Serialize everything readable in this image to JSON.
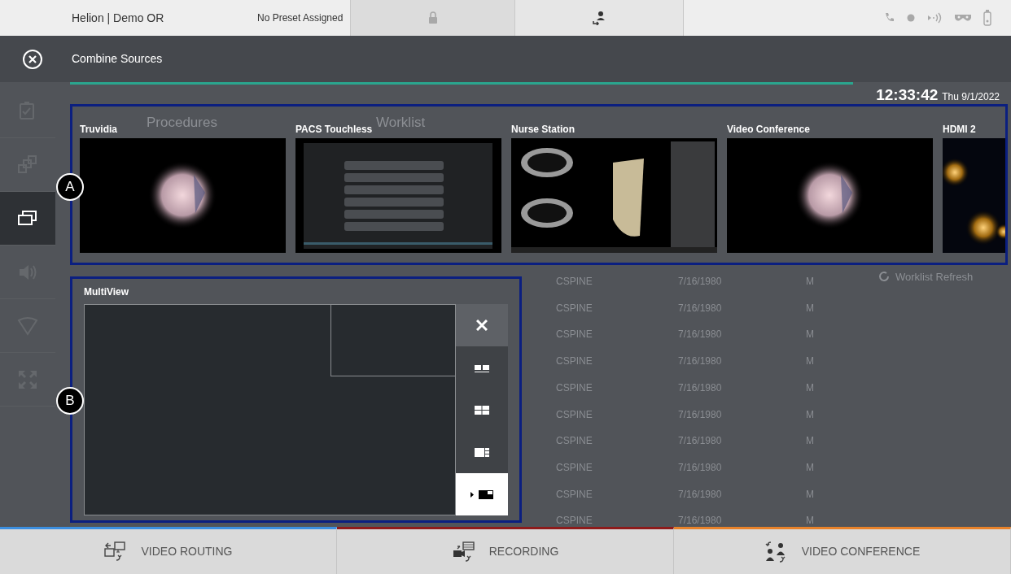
{
  "top_bar": {
    "location": "Helion | Demo OR",
    "preset": "No Preset Assigned"
  },
  "dialog": {
    "title": "Combine Sources"
  },
  "clock": {
    "time": "12:33:42",
    "date": "Thu 9/1/2022"
  },
  "sidebar": {
    "items": [
      {
        "kind": "checklist",
        "selected": false
      },
      {
        "kind": "stack",
        "selected": false
      },
      {
        "kind": "multiview",
        "selected": true
      },
      {
        "kind": "speaker",
        "selected": false
      },
      {
        "kind": "cone",
        "selected": false
      },
      {
        "kind": "expand",
        "selected": false
      }
    ]
  },
  "background": {
    "headings": [
      "Procedures",
      "Worklist"
    ],
    "refresh": "Worklist Refresh",
    "rows": [
      {
        "procedure": "CSPINE",
        "birth_date": "7/16/1980",
        "sex": "M"
      },
      {
        "procedure": "CSPINE",
        "birth_date": "7/16/1980",
        "sex": "M"
      },
      {
        "procedure": "CSPINE",
        "birth_date": "7/16/1980",
        "sex": "M"
      },
      {
        "procedure": "CSPINE",
        "birth_date": "7/16/1980",
        "sex": "M"
      },
      {
        "procedure": "CSPINE",
        "birth_date": "7/16/1980",
        "sex": "M"
      },
      {
        "procedure": "CSPINE",
        "birth_date": "7/16/1980",
        "sex": "M"
      },
      {
        "procedure": "CSPINE",
        "birth_date": "7/16/1980",
        "sex": "M"
      },
      {
        "procedure": "CSPINE",
        "birth_date": "7/16/1980",
        "sex": "M"
      },
      {
        "procedure": "CSPINE",
        "birth_date": "7/16/1980",
        "sex": "M"
      },
      {
        "procedure": "CSPINE",
        "birth_date": "7/16/1980",
        "sex": "M"
      }
    ]
  },
  "sources": {
    "callout": "A",
    "items": [
      {
        "label": "Truvidia"
      },
      {
        "label": "PACS Touchless"
      },
      {
        "label": "Nurse Station"
      },
      {
        "label": "Video Conference"
      },
      {
        "label": "HDMI 2"
      }
    ]
  },
  "multiview": {
    "callout": "B",
    "title": "MultiView",
    "layouts": [
      {
        "kind": "side-by-side",
        "selected": false
      },
      {
        "kind": "quad",
        "selected": false
      },
      {
        "kind": "main-three",
        "selected": false
      },
      {
        "kind": "pip",
        "selected": true
      }
    ]
  },
  "bottom_tabs": [
    {
      "label": "VIDEO ROUTING",
      "kind": "routing",
      "color": "#3c8fe0"
    },
    {
      "label": "RECORDING",
      "kind": "recording",
      "color": "#8e1b1b"
    },
    {
      "label": "VIDEO CONFERENCE",
      "kind": "conference",
      "color": "#e8822a"
    }
  ]
}
